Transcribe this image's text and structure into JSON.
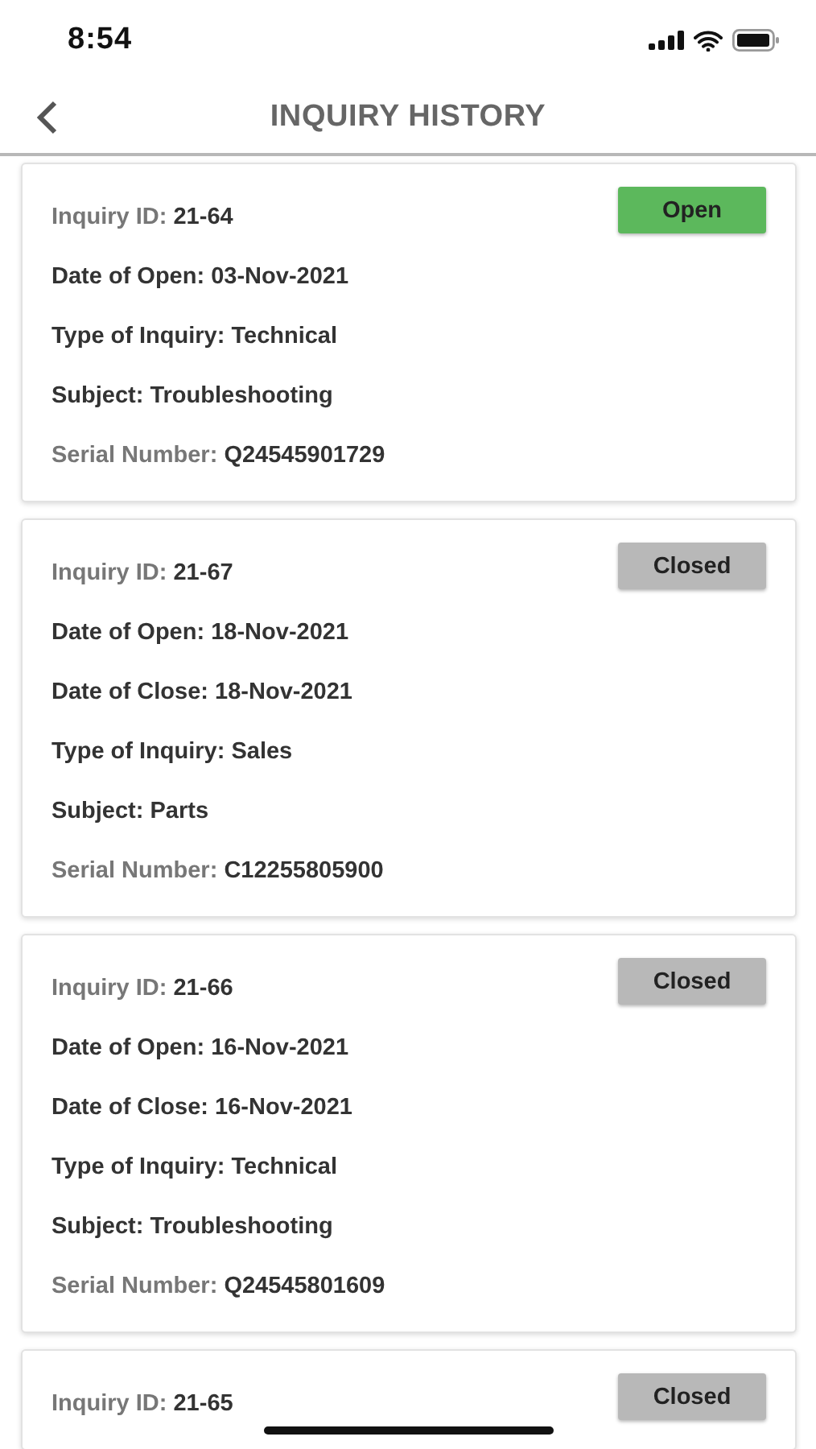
{
  "status_bar": {
    "time": "8:54"
  },
  "header": {
    "title": "INQUIRY HISTORY"
  },
  "inquiries": [
    {
      "status": {
        "label": "Open",
        "kind": "open"
      },
      "fields": [
        {
          "label": "Inquiry ID:",
          "value": "21-64",
          "kind": "muted"
        },
        {
          "label": "Date of Open:",
          "value": "03-Nov-2021",
          "kind": "strong"
        },
        {
          "label": "Type of Inquiry:",
          "value": "Technical",
          "kind": "strong"
        },
        {
          "label": "Subject:",
          "value": "Troubleshooting",
          "kind": "strong"
        },
        {
          "label": "Serial Number:",
          "value": "Q24545901729",
          "kind": "muted"
        }
      ]
    },
    {
      "status": {
        "label": "Closed",
        "kind": "closed"
      },
      "fields": [
        {
          "label": "Inquiry ID:",
          "value": "21-67",
          "kind": "muted"
        },
        {
          "label": "Date of Open:",
          "value": "18-Nov-2021",
          "kind": "strong"
        },
        {
          "label": "Date of Close:",
          "value": "18-Nov-2021",
          "kind": "strong"
        },
        {
          "label": "Type of Inquiry:",
          "value": "Sales",
          "kind": "strong"
        },
        {
          "label": "Subject:",
          "value": "Parts",
          "kind": "strong"
        },
        {
          "label": "Serial Number:",
          "value": "C12255805900",
          "kind": "muted"
        }
      ]
    },
    {
      "status": {
        "label": "Closed",
        "kind": "closed"
      },
      "fields": [
        {
          "label": "Inquiry ID:",
          "value": "21-66",
          "kind": "muted"
        },
        {
          "label": "Date of Open:",
          "value": "16-Nov-2021",
          "kind": "strong"
        },
        {
          "label": "Date of Close:",
          "value": "16-Nov-2021",
          "kind": "strong"
        },
        {
          "label": "Type of Inquiry:",
          "value": "Technical",
          "kind": "strong"
        },
        {
          "label": "Subject:",
          "value": "Troubleshooting",
          "kind": "strong"
        },
        {
          "label": "Serial Number:",
          "value": "Q24545801609",
          "kind": "muted"
        }
      ]
    },
    {
      "status": {
        "label": "Closed",
        "kind": "closed"
      },
      "fields": [
        {
          "label": "Inquiry ID:",
          "value": "21-65",
          "kind": "muted"
        }
      ]
    }
  ]
}
